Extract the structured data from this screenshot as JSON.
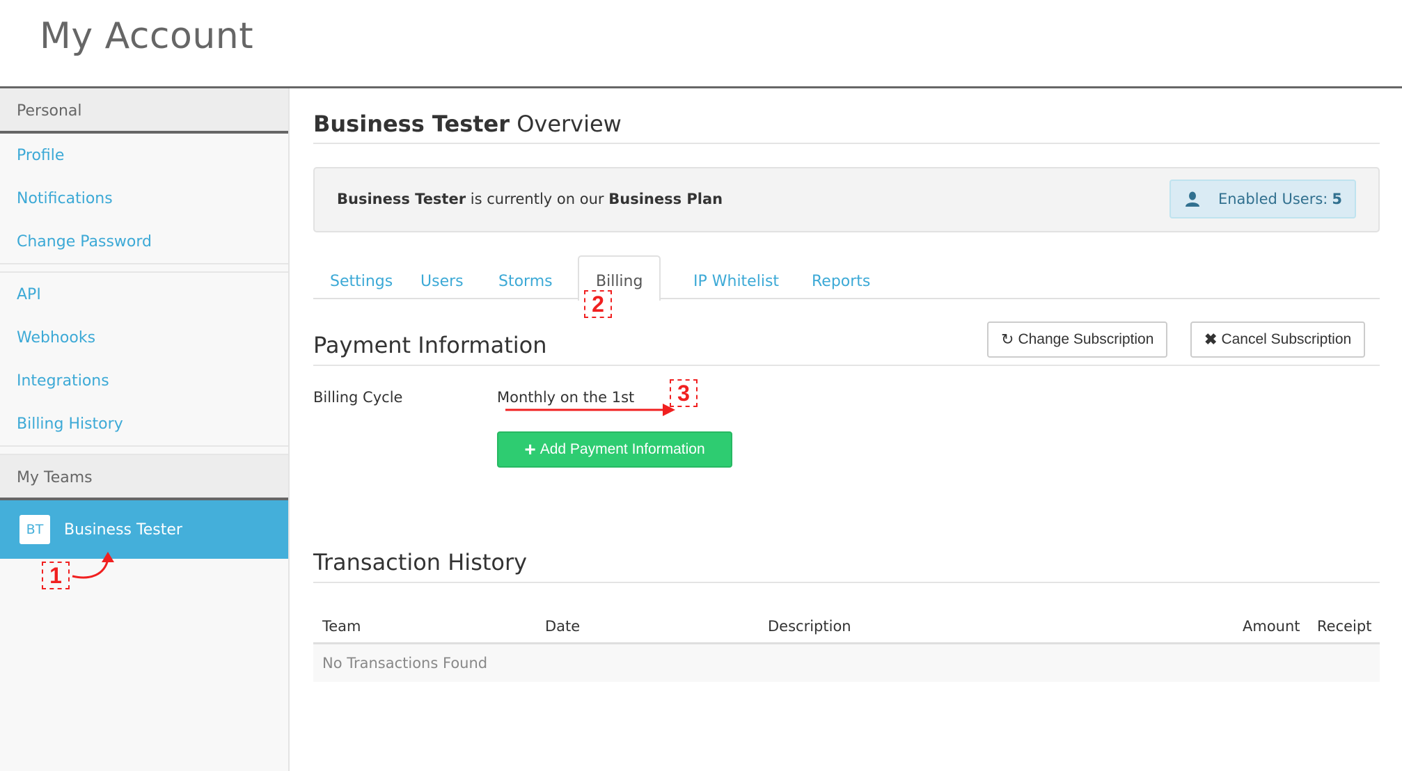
{
  "header": {
    "title": "My Account"
  },
  "sidebar": {
    "personal_heading": "Personal",
    "personal_items": [
      {
        "label": "Profile"
      },
      {
        "label": "Notifications"
      },
      {
        "label": "Change Password"
      }
    ],
    "dev_items": [
      {
        "label": "API"
      },
      {
        "label": "Webhooks"
      },
      {
        "label": "Integrations"
      },
      {
        "label": "Billing History"
      }
    ],
    "teams_heading": "My Teams",
    "teams": [
      {
        "initials": "BT",
        "name": "Business Tester",
        "selected": true
      }
    ]
  },
  "overview": {
    "team_name": "Business Tester",
    "title_suffix": "Overview",
    "plan_team": "Business Tester",
    "plan_middle": "is currently on our",
    "plan_name": "Business Plan",
    "enabled_users_label": "Enabled Users:",
    "enabled_users_count": "5",
    "user_icon": "user-icon"
  },
  "tabs": [
    {
      "label": "Settings",
      "active": false
    },
    {
      "label": "Users",
      "active": false
    },
    {
      "label": "Storms",
      "active": false
    },
    {
      "label": "Billing",
      "active": true
    },
    {
      "label": "IP Whitelist",
      "active": false
    },
    {
      "label": "Reports",
      "active": false
    }
  ],
  "payment": {
    "heading": "Payment Information",
    "change_subscription_label": "Change Subscription",
    "change_subscription_icon": "refresh-icon",
    "cancel_subscription_label": "Cancel Subscription",
    "cancel_subscription_icon": "close-icon",
    "billing_cycle_label": "Billing Cycle",
    "billing_cycle_value": "Monthly on the 1st",
    "add_payment_label": "Add Payment Information",
    "add_payment_icon": "plus-icon"
  },
  "transactions": {
    "heading": "Transaction History",
    "columns": [
      "Team",
      "Date",
      "Description",
      "Amount",
      "Receipt"
    ],
    "empty_message": "No Transactions Found"
  },
  "annotations": [
    {
      "number": "1",
      "target": "team Business Tester"
    },
    {
      "number": "2",
      "target": "Billing tab"
    },
    {
      "number": "3",
      "target": "Billing Cycle value"
    }
  ],
  "colors": {
    "link": "#3ca9d6",
    "team_selected_bg": "#44afda",
    "success": "#2ecc71",
    "info_badge_bg": "#daebf4",
    "info_badge_text": "#31708f",
    "annotation": "#f02020"
  }
}
